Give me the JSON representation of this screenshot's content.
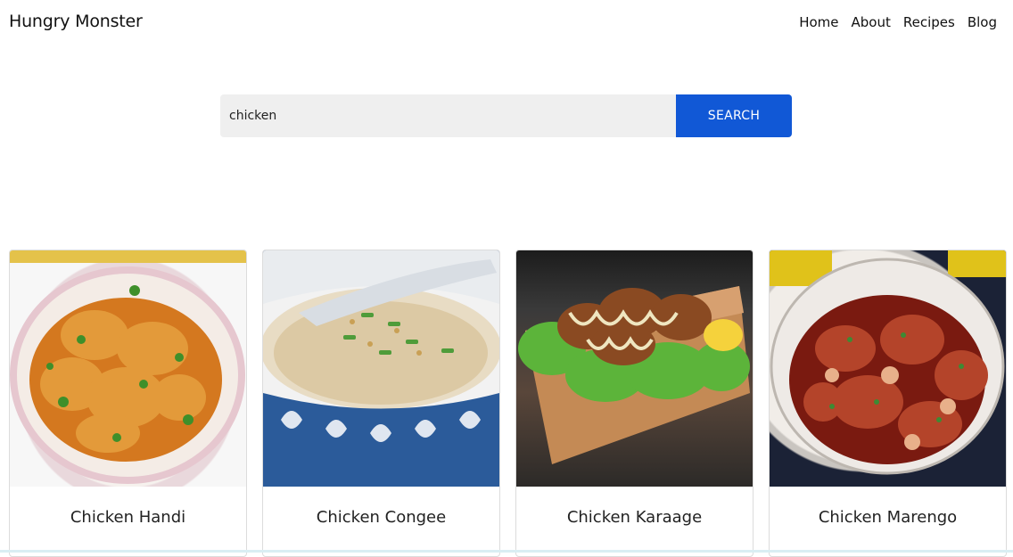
{
  "navbar": {
    "brand": "Hungry Monster",
    "links": [
      "Home",
      "About",
      "Recipes",
      "Blog"
    ]
  },
  "search": {
    "value": "chicken",
    "placeholder": "",
    "button_label": "SEARCH"
  },
  "results": [
    {
      "title": "Chicken Handi"
    },
    {
      "title": "Chicken Congee"
    },
    {
      "title": "Chicken Karaage"
    },
    {
      "title": "Chicken Marengo"
    }
  ],
  "colors": {
    "accent": "#1158d6",
    "search_bg": "#efefef"
  }
}
